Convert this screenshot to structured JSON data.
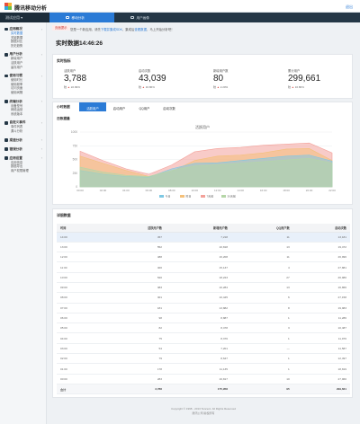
{
  "header": {
    "brand": "腾讯移动分析",
    "logout": "退出"
  },
  "nav": {
    "app": "测试应用 ▾",
    "tabs": [
      {
        "label": "移动分析",
        "active": true
      },
      {
        "label": "用户画像",
        "active": false
      }
    ]
  },
  "sidebar": {
    "groups": [
      {
        "label": "应用概况",
        "items": [
          "实时数据",
          "关键数据",
          "数据对比",
          "历史趋势"
        ]
      },
      {
        "label": "用户分析",
        "items": [
          "新增用户",
          "活跃用户",
          "留存用户"
        ]
      },
      {
        "label": "使用习惯",
        "items": [
          "使用时长",
          "使用频率",
          "访问页面",
          "使用间隔"
        ]
      },
      {
        "label": "终端分析",
        "items": [
          "设备型号",
          "网络运营",
          "系统版本"
        ]
      },
      {
        "label": "自定义事件",
        "items": [
          "事件列表",
          "漏斗分析"
        ]
      },
      {
        "label": "渠道分析",
        "items": []
      },
      {
        "label": "错误分析",
        "items": []
      },
      {
        "label": "应用设置",
        "items": [
          "应用信息",
          "数据导出",
          "用户权限管理"
        ]
      }
    ]
  },
  "breadcrumb": {
    "label": "页面提示",
    "text_prefix": "您是一个新应用，请先",
    "link1": "下载并集成SDK",
    "text_mid": "，集成后",
    "link2": "查看数据",
    "text_suffix": "，马上开始分析吧！"
  },
  "page_title": "实时数据14:46:26",
  "realtime_card": {
    "title": "实时指标",
    "kpis": [
      {
        "label": "活跃用户",
        "value": "3,788",
        "delta_label": "较",
        "delta": "22.99%"
      },
      {
        "label": "启动次数",
        "value": "43,039",
        "delta_label": "较",
        "delta": "16.86%"
      },
      {
        "label": "新增用户数",
        "value": "80",
        "delta_label": "较",
        "delta": "2.20%"
      },
      {
        "label": "累计用户",
        "value": "299,661",
        "delta_label": "较",
        "delta": "16.86%"
      }
    ]
  },
  "hourly_card": {
    "title": "小时数据",
    "tabs": [
      {
        "label": "活跃用户",
        "active": true
      },
      {
        "label": "启动用户",
        "active": false
      },
      {
        "label": "QQ用户",
        "active": false
      },
      {
        "label": "启动次数",
        "active": false
      }
    ],
    "chart_heading": "日数据量"
  },
  "chart_data": {
    "type": "area",
    "title": "活跃用户",
    "x": [
      "00:00",
      "02:00",
      "04:00",
      "06:00",
      "08:00",
      "10:00",
      "12:00",
      "14:00",
      "16:00",
      "18:00",
      "20:00",
      "22:00"
    ],
    "ylim": [
      0,
      1000
    ],
    "yticks": [
      0,
      250,
      500,
      750,
      1000
    ],
    "grid": true,
    "legend": "bottom",
    "series": [
      {
        "name": "今日",
        "color": "#7ec8e3",
        "values": [
          300,
          230,
          190,
          175,
          330,
          430,
          440,
          480,
          520,
          560,
          580,
          470
        ]
      },
      {
        "name": "昨日",
        "color": "#f4c07a",
        "values": [
          560,
          430,
          300,
          190,
          280,
          480,
          560,
          580,
          620,
          690,
          700,
          480
        ]
      },
      {
        "name": "7天前",
        "color": "#f3a19a",
        "values": [
          650,
          480,
          330,
          230,
          400,
          640,
          700,
          720,
          760,
          780,
          800,
          620
        ]
      },
      {
        "name": "30天前",
        "color": "#b5d6a7",
        "values": [
          360,
          270,
          210,
          190,
          300,
          380,
          400,
          430,
          460,
          490,
          520,
          430
        ]
      }
    ]
  },
  "detail_card": {
    "title": "详细数据",
    "columns": [
      "时间",
      "活跃用户数",
      "新增用户数",
      "QQ用户数",
      "启动次数"
    ],
    "rows": [
      [
        "14:00",
        "457",
        "7,218",
        "11",
        "13,181"
      ],
      [
        "13:00",
        "552",
        "10,818",
        "13",
        "19,472"
      ],
      [
        "12:00",
        "488",
        "16,208",
        "11",
        "26,996"
      ],
      [
        "11:00",
        "400",
        "15,137",
        "4",
        "27,881"
      ],
      [
        "10:00",
        "520",
        "18,223",
        "27",
        "26,980"
      ],
      [
        "09:00",
        "383",
        "10,284",
        "13",
        "16,866"
      ],
      [
        "08:00",
        "301",
        "10,445",
        "6",
        "27,158"
      ],
      [
        "07:00",
        "181",
        "13,882",
        "8",
        "19,983"
      ],
      [
        "06:00",
        "98",
        "8,887",
        "1",
        "11,286"
      ],
      [
        "05:00",
        "82",
        "8,478",
        "3",
        "10,487"
      ],
      [
        "04:00",
        "75",
        "8,376",
        "1",
        "11,976"
      ],
      [
        "03:00",
        "54",
        "7,201",
        "—",
        "11,587"
      ],
      [
        "02:00",
        "79",
        "8,647",
        "1",
        "12,497"
      ],
      [
        "01:00",
        "178",
        "11,135",
        "1",
        "18,819"
      ],
      [
        "00:00",
        "283",
        "16,817",
        "10",
        "27,960"
      ]
    ],
    "total": [
      "合计",
      "3,788",
      "175,958",
      "95",
      "299,661"
    ]
  },
  "footer": {
    "line1": "Copyright © 1998 - 2013 Tencent. All Rights Reserved",
    "line2": "腾讯公司 版权所有"
  }
}
